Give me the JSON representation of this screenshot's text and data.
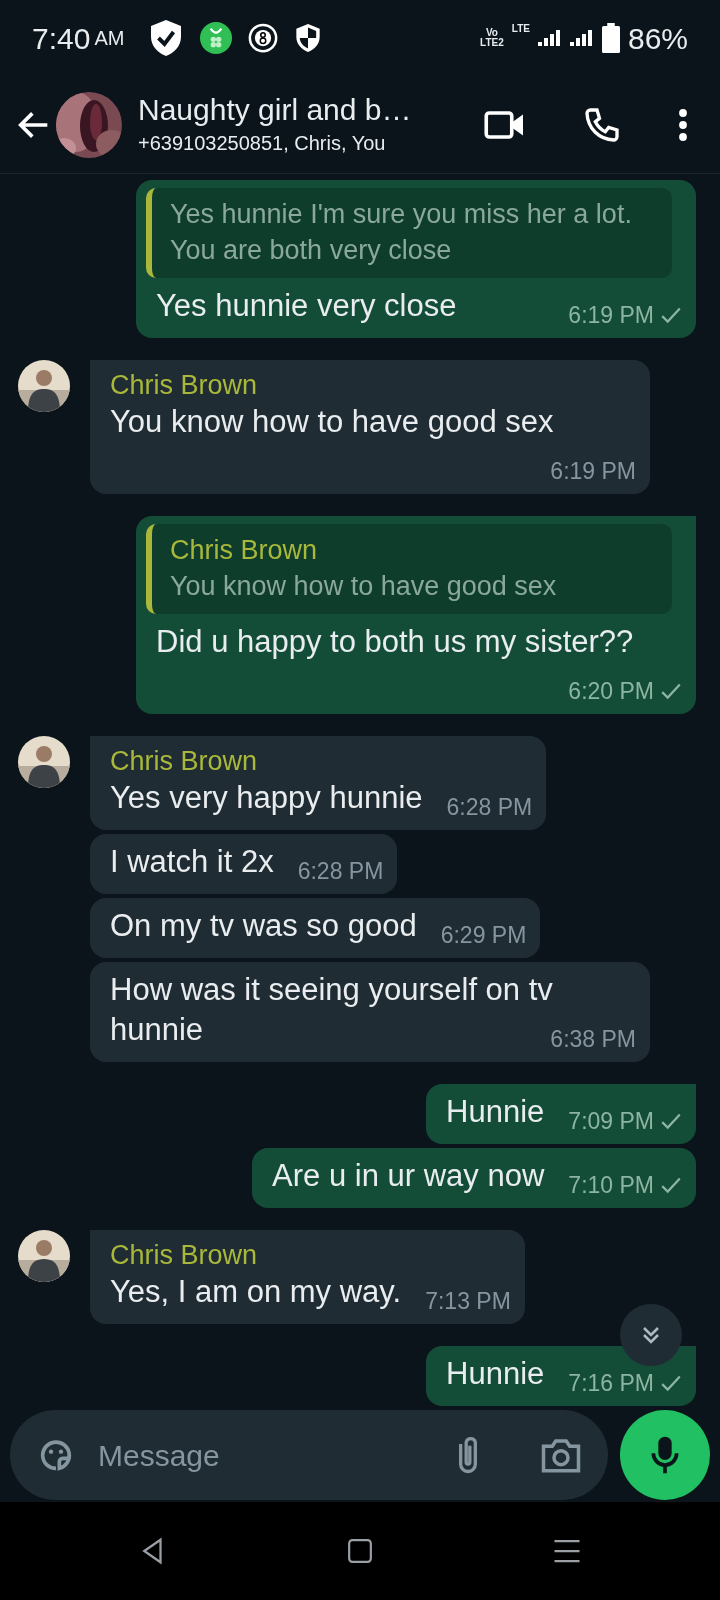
{
  "status_bar": {
    "time": "7:40",
    "meridiem": "AM",
    "volte_top": "Vo",
    "volte_bottom": "LTE2",
    "network": "LTE",
    "battery": "86%"
  },
  "header": {
    "title": "Naughty girl and b…",
    "subtitle": "+639103250851, Chris, You"
  },
  "messages": [
    {
      "kind": "out",
      "tail": false,
      "quote": {
        "text": "Yes hunnie I'm sure you miss her a lot. You are both very close"
      },
      "text": "Yes hunnie very close",
      "time": "6:19 PM",
      "read": false
    },
    {
      "kind": "in",
      "tail": true,
      "avatar": true,
      "sender": "Chris Brown",
      "text": "You know how to have good sex",
      "time": "6:19 PM"
    },
    {
      "kind": "out",
      "tail": true,
      "quote": {
        "sender": "Chris Brown",
        "text": "You know how to have good sex"
      },
      "text": "Did u happy to both us my sister??",
      "time": "6:20 PM",
      "read": false
    },
    {
      "kind": "in",
      "tail": true,
      "avatar": true,
      "sender": "Chris Brown",
      "text": "Yes very happy hunnie",
      "time": "6:28 PM"
    },
    {
      "kind": "in",
      "tail": false,
      "avatar": false,
      "text": "I watch it 2x",
      "time": "6:28 PM"
    },
    {
      "kind": "in",
      "tail": false,
      "avatar": false,
      "text": "On my tv was so good",
      "time": "6:29 PM"
    },
    {
      "kind": "in",
      "tail": false,
      "avatar": false,
      "text": "How was it seeing yourself on tv hunnie",
      "time": "6:38 PM"
    },
    {
      "kind": "out",
      "tail": true,
      "text": "Hunnie",
      "time": "7:09 PM",
      "read": false
    },
    {
      "kind": "out",
      "tail": false,
      "text": "Are u in ur way now",
      "time": "7:10 PM",
      "read": false
    },
    {
      "kind": "in",
      "tail": true,
      "avatar": true,
      "sender": "Chris Brown",
      "text": "Yes, I am on my way.",
      "time": "7:13 PM"
    },
    {
      "kind": "out",
      "tail": true,
      "text": "Hunnie",
      "time": "7:16 PM",
      "read": false
    }
  ],
  "composer": {
    "placeholder": "Message"
  }
}
